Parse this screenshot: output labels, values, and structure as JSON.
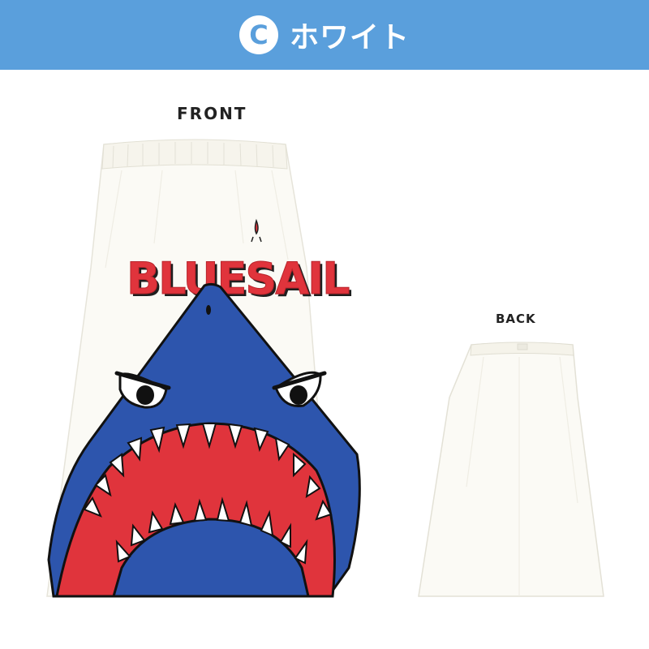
{
  "banner": {
    "badge_letter": "C",
    "title": "ホワイト",
    "color": "#5a9fdc"
  },
  "front": {
    "label": "FRONT",
    "print_text": "BLUESAIL"
  },
  "back": {
    "label": "BACK"
  },
  "colors": {
    "shark_blue": "#2d55ad",
    "mouth_red": "#e0343c",
    "towel_white": "#fbfaf5"
  }
}
